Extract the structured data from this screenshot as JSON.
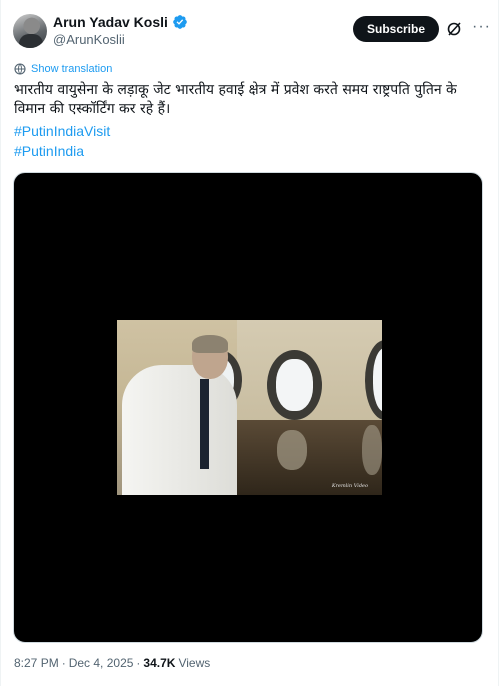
{
  "author": {
    "display_name": "Arun Yadav Kosli",
    "handle": "@ArunKoslii",
    "verified": true
  },
  "actions": {
    "subscribe_label": "Subscribe",
    "grok_icon": "slashed-circle-icon",
    "more_icon": "more-horizontal-icon"
  },
  "translation": {
    "label": "Show translation",
    "icon": "globe-icon"
  },
  "tweet": {
    "text": "भारतीय वायुसेना के लड़ाकू जेट भारतीय हवाई क्षेत्र में प्रवेश करते समय राष्ट्रपति पुतिन के विमान की एस्कॉर्टिंग  कर रहे हैं।",
    "hashtags": [
      "#PutinIndiaVisit",
      "#PutinIndia"
    ]
  },
  "media": {
    "type": "video",
    "watermark": "Kremlin Video"
  },
  "footer": {
    "time": "8:27 PM",
    "separator": "·",
    "date": "Dec 4, 2025",
    "views_count": "34.7K",
    "views_label": "Views"
  },
  "colors": {
    "accent": "#1d9bf0",
    "text": "#0f1419",
    "secondary": "#536471",
    "button_bg": "#0f1419"
  }
}
